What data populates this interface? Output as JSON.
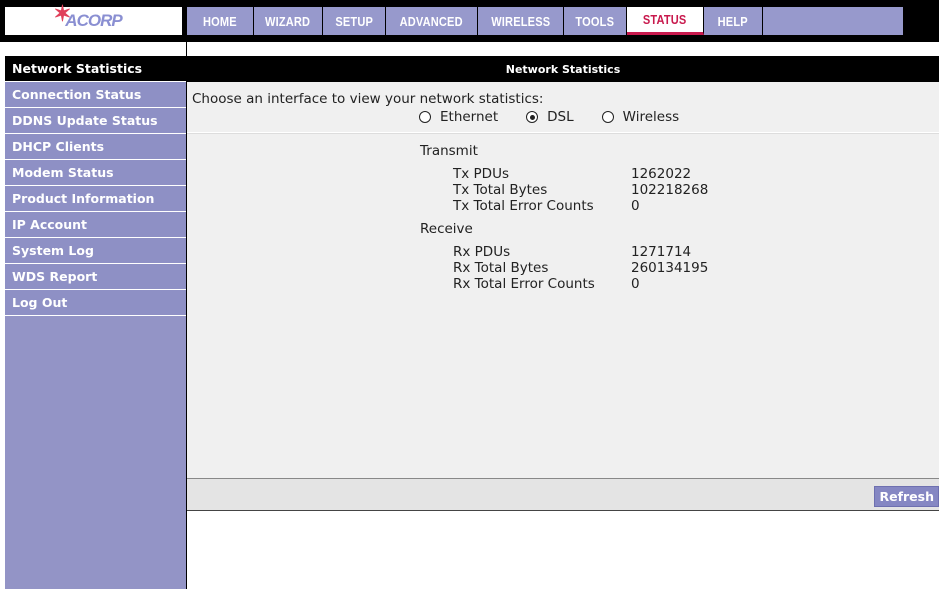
{
  "brand": {
    "logo_text": "ACORP",
    "logo_mark": "✶"
  },
  "nav": {
    "items": [
      {
        "label": "HOME"
      },
      {
        "label": "WIZARD"
      },
      {
        "label": "SETUP"
      },
      {
        "label": "ADVANCED"
      },
      {
        "label": "WIRELESS"
      },
      {
        "label": "TOOLS"
      },
      {
        "label": "STATUS"
      },
      {
        "label": "HELP"
      }
    ],
    "active": "STATUS"
  },
  "sidebar": {
    "items": [
      {
        "label": "Network Statistics"
      },
      {
        "label": "Connection Status"
      },
      {
        "label": "DDNS Update Status"
      },
      {
        "label": "DHCP Clients"
      },
      {
        "label": "Modem Status"
      },
      {
        "label": "Product Information"
      },
      {
        "label": "IP Account"
      },
      {
        "label": "System Log"
      },
      {
        "label": "WDS Report"
      },
      {
        "label": "Log Out"
      }
    ],
    "active": "Network Statistics"
  },
  "main": {
    "title": "Network Statistics",
    "prompt": "Choose an interface to view your network statistics:",
    "interfaces": [
      {
        "label": "Ethernet",
        "checked": false
      },
      {
        "label": "DSL",
        "checked": true
      },
      {
        "label": "Wireless",
        "checked": false
      }
    ],
    "transmit": {
      "heading": "Transmit",
      "rows": [
        {
          "label": "Tx PDUs",
          "value": "1262022"
        },
        {
          "label": "Tx Total Bytes",
          "value": "102218268"
        },
        {
          "label": "Tx Total Error Counts",
          "value": "0"
        }
      ]
    },
    "receive": {
      "heading": "Receive",
      "rows": [
        {
          "label": "Rx PDUs",
          "value": "1271714"
        },
        {
          "label": "Rx Total Bytes",
          "value": "260134195"
        },
        {
          "label": "Rx Total Error Counts",
          "value": "0"
        }
      ]
    },
    "refresh_label": "Refresh"
  },
  "colors": {
    "nav_bg": "#9799cc",
    "active_accent": "#c8194d",
    "sidebar_bg": "#8e90c5"
  }
}
